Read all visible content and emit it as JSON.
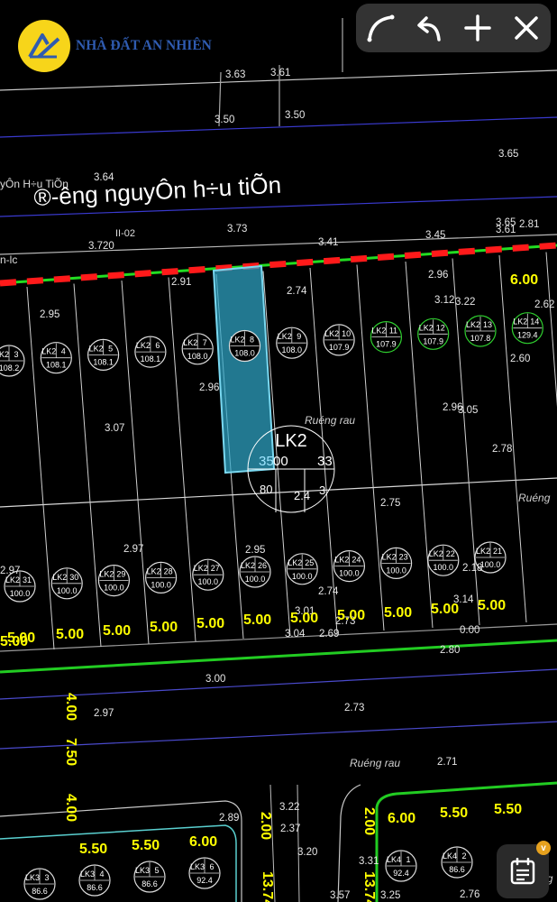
{
  "brand": {
    "name": "NHÀ ĐẤT AN NHIÊN"
  },
  "toolbar": {
    "icons": [
      "curve-icon",
      "undo-icon",
      "plus-icon",
      "close-icon"
    ]
  },
  "fab": {
    "icon": "calendar-note-icon",
    "badge": "v"
  },
  "street_labels": [
    {
      "id": "street-main",
      "text": "®-êng nguyÔn h÷u tiÕn"
    },
    {
      "id": "street-small",
      "text": "yÔn H÷u TiÕn"
    },
    {
      "id": "street-left",
      "text": "n-lc"
    },
    {
      "id": "code-label",
      "text": "II-02"
    }
  ],
  "block_label": "LK2",
  "selected_lot_dims": [
    "35",
    "00",
    "33",
    "80",
    "2.4",
    "3"
  ],
  "road_labels": [
    "Ruéng rau",
    "Ruéng rau",
    "Ruéng",
    "Ruéng"
  ],
  "lots_row1": [
    {
      "name": "LK2",
      "no": "3",
      "area": "108.2"
    },
    {
      "name": "LK2",
      "no": "4",
      "area": "108.1"
    },
    {
      "name": "LK2",
      "no": "5",
      "area": "108.1"
    },
    {
      "name": "LK2",
      "no": "6",
      "area": "108.1"
    },
    {
      "name": "LK2",
      "no": "7",
      "area": "108.0"
    },
    {
      "name": "LK2",
      "no": "8",
      "area": "108.0"
    },
    {
      "name": "LK2",
      "no": "9",
      "area": "108.0"
    },
    {
      "name": "LK2",
      "no": "10",
      "area": "107.9"
    },
    {
      "name": "LK2",
      "no": "11",
      "area": "107.9"
    },
    {
      "name": "LK2",
      "no": "12",
      "area": "107.9"
    },
    {
      "name": "LK2",
      "no": "13",
      "area": "107.8"
    },
    {
      "name": "LK2",
      "no": "14",
      "area": "129.4"
    }
  ],
  "lots_row2": [
    {
      "name": "LK2",
      "no": "31",
      "area": "100.0"
    },
    {
      "name": "LK2",
      "no": "30",
      "area": "100.0"
    },
    {
      "name": "LK2",
      "no": "29",
      "area": "100.0"
    },
    {
      "name": "LK2",
      "no": "28",
      "area": "100.0"
    },
    {
      "name": "LK2",
      "no": "27",
      "area": "100.0"
    },
    {
      "name": "LK2",
      "no": "26",
      "area": "100.0"
    },
    {
      "name": "LK2",
      "no": "25",
      "area": "100.0"
    },
    {
      "name": "LK2",
      "no": "24",
      "area": "100.0"
    },
    {
      "name": "LK2",
      "no": "23",
      "area": "100.0"
    },
    {
      "name": "LK2",
      "no": "22",
      "area": "100.0"
    },
    {
      "name": "LK2",
      "no": "21",
      "area": "100.0"
    }
  ],
  "lots_row3": [
    {
      "name": "LK3",
      "no": "3",
      "area": "86.6"
    },
    {
      "name": "LK3",
      "no": "4",
      "area": "86.6"
    },
    {
      "name": "LK3",
      "no": "5",
      "area": "86.6"
    },
    {
      "name": "LK3",
      "no": "6",
      "area": "92.4"
    }
  ],
  "lots_row4": [
    {
      "name": "LK4",
      "no": "1",
      "area": "92.4"
    },
    {
      "name": "LK4",
      "no": "2",
      "area": "86.6"
    }
  ],
  "elevations": [
    "3.63",
    "3.61",
    "3.50",
    "3.50",
    "3.64",
    "3.65",
    "3.73",
    "3.720",
    "3.41",
    "3.45",
    "3.65",
    "3.61",
    "2.81",
    "2.91",
    "2.74",
    "2.96",
    "3.12",
    "3.22",
    "2.62",
    "2.95",
    "2.60",
    "2.96",
    "2.96",
    "3.05",
    "3.07",
    "2.78",
    "2.75",
    "2.97",
    "2.95",
    "2.97",
    "2.74",
    "3.01",
    "2.73",
    "3.14",
    "3.04",
    "2.69",
    "2.80",
    "0.00",
    "3.00",
    "2.97",
    "2.73",
    "2.71",
    "2.89",
    "3.22",
    "2.37",
    "3.20",
    "3.31",
    "3.57",
    "3.25",
    "2.76",
    "2.18"
  ],
  "road_widths": [
    "6.00",
    "5.00",
    "5.00",
    "5.00",
    "5.00",
    "5.00",
    "5.00",
    "5.00",
    "5.00",
    "5.00",
    "5.00",
    "5.00",
    "5.00",
    "4.00",
    "7.50",
    "4.00",
    "5.50",
    "5.50",
    "6.00",
    "2.00",
    "13.74",
    "2.00",
    "13.74",
    "6.00",
    "5.50",
    "5.50"
  ]
}
